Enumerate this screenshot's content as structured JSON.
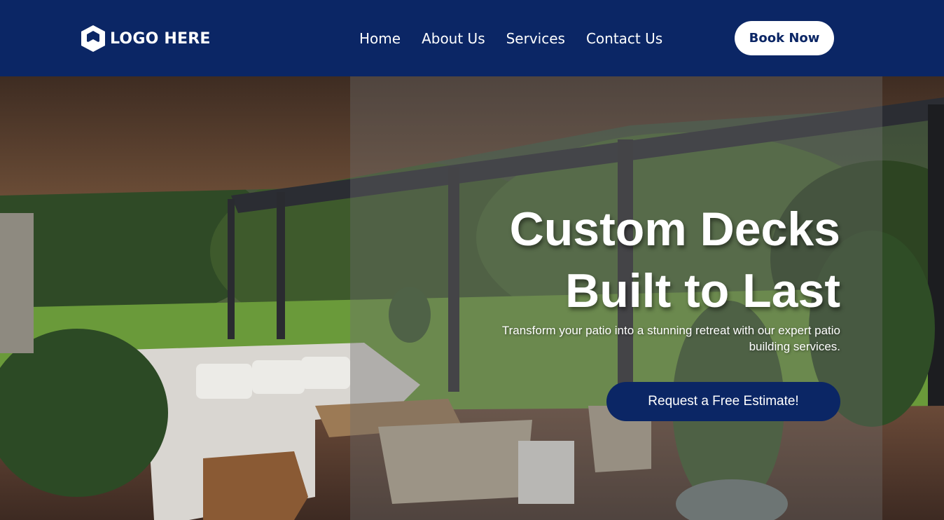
{
  "header": {
    "logo_text": "LOGO HERE",
    "nav": [
      "Home",
      "About Us",
      "Services",
      "Contact Us"
    ],
    "cta_label": "Book Now"
  },
  "hero": {
    "headline_line1": "Custom Decks",
    "headline_line2": "Built to Last",
    "subtext": "Transform your patio into a stunning retreat with our expert patio building services.",
    "cta_label": "Request a Free Estimate!"
  },
  "colors": {
    "brand_navy": "#0b2665",
    "text_white": "#ffffff",
    "overlay_gray": "rgba(110,110,110,0.38)"
  },
  "icons": [
    "hexagon-logo-icon"
  ]
}
